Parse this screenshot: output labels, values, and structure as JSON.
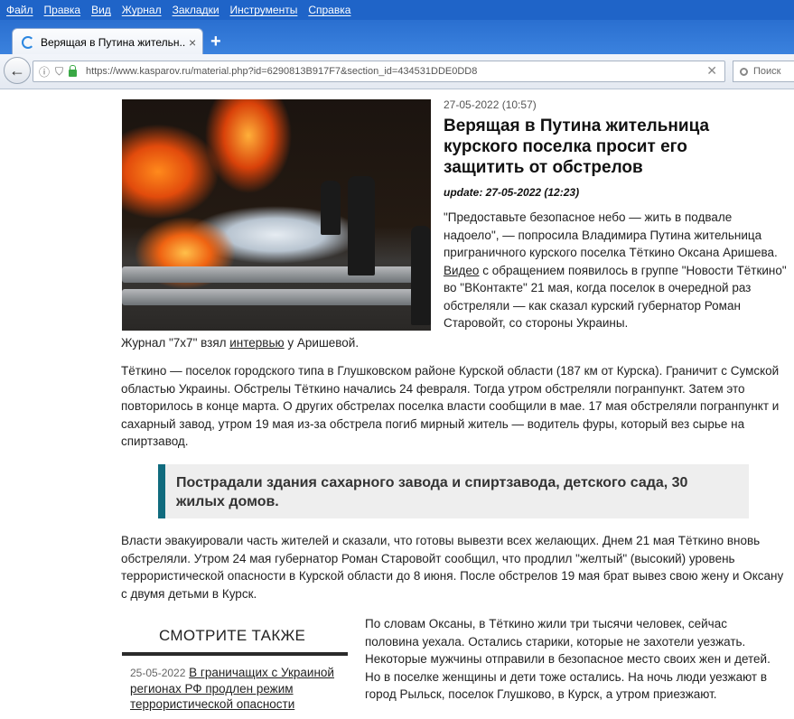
{
  "browser": {
    "menu": [
      "Файл",
      "Правка",
      "Вид",
      "Журнал",
      "Закладки",
      "Инструменты",
      "Справка"
    ],
    "tab_title": "Верящая в Путина жительн...",
    "tab_close": "×",
    "new_tab": "+",
    "url": "https://www.kasparov.ru/material.php?id=6290813B917F7&section_id=434531DDE0DD8",
    "url_clear": "✕",
    "search_placeholder": "Поиск"
  },
  "article": {
    "date": "27-05-2022 (10:57)",
    "title": "Верящая в Путина жительница курского поселка просит его защитить от обстрелов",
    "update": "update: 27-05-2022 (12:23)",
    "lead_1": "\"Предоставьте безопасное небо — жить в подвале надоело\", — попросила Владимира Путина жительница приграничного курского поселка Тёткино Оксана Аришева. ",
    "lead_link_video": "Видео",
    "lead_2": " с обращением появилось в группе \"Новости Тёткино\" во \"ВКонтакте\" 21 мая, когда поселок в очередной раз обстреляли — как сказал курский губернатор Роман Старовойт, со стороны Украины.",
    "lead_3": "Журнал \"7x7\" взял ",
    "lead_link_interview": "интервью",
    "lead_4": " у Аришевой.",
    "paragraph_2": "Тёткино — поселок городского типа в Глушковском районе Курской области (187 км от Курска). Граничит с Сумской областью Украины. Обстрелы Тёткино начались 24 февраля. Тогда утром обстреляли погранпункт. Затем это повторилось в конце марта. О других обстрелах поселка власти сообщили в мае. 17 мая обстреляли погранпункт и сахарный завод, утром 19 мая из-за обстрела погиб мирный житель — водитель фуры, который вез сырье на спиртзавод.",
    "quote": "Пострадали здания сахарного завода и спиртзавода, детского сада, 30 жилых домов.",
    "paragraph_3": "Власти эвакуировали часть жителей и сказали, что готовы вывезти всех желающих. Днем 21 мая Тёткино вновь обстреляли. Утром 24 мая губернатор Роман Старовойт сообщил, что продлил \"желтый\" (высокий) уровень террористической опасности в Курской области до 8 июня. После обстрелов 19 мая брат вывез свою жену и Оксану с двумя детьми в Курск.",
    "paragraph_4": "По словам Оксаны, в Тёткино жили три тысячи человек, сейчас половина уехала. Остались старики, которые не захотели уезжать. Некоторые мужчины отправили в безопасное место своих жен и детей. Но в поселке женщины и дети тоже остались. На ночь люди уезжают в город Рыльск, поселок Глушково, в Курск, а утром приезжают."
  },
  "see_also": {
    "title": "СМОТРИТЕ ТАКЖЕ",
    "items": [
      {
        "date": "25-05-2022",
        "title": "В граничащих с Украиной регионах РФ продлен режим террористической опасности"
      }
    ]
  },
  "colors": {
    "menubar": "#1f64c8",
    "quote_accent": "#106b7e",
    "lock": "#39a845"
  }
}
